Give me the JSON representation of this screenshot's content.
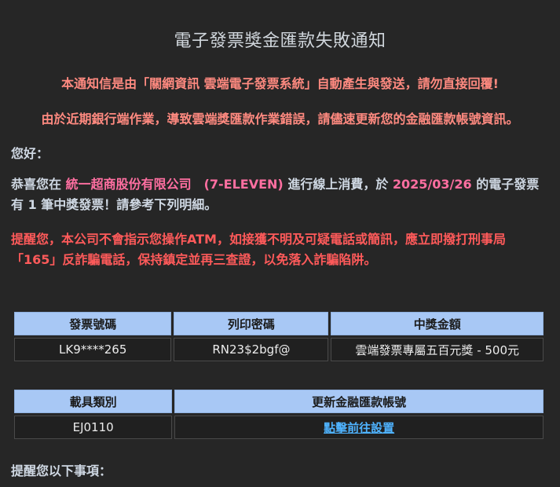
{
  "email": {
    "title": "電子發票獎金匯款失敗通知",
    "notice_auto": "本通知信是由「關網資訊 雲端電子發票系統」自動產生與發送，請勿直接回覆!",
    "notice_error": "由於近期銀行端作業，導致雲端獎匯款作業錯誤，請儘速更新您的金融匯款帳號資訊。",
    "greeting": "您好：",
    "congrats": {
      "prefix": "恭喜您在 ",
      "merchant": "統一超商股份有限公司　(7-ELEVEN)",
      "middle": " 進行線上消費，於 ",
      "date": "2025/03/26",
      "suffix_before_count": " 的電子發票有 ",
      "count": "1",
      "suffix": " 筆中獎發票！請參考下列明細。"
    },
    "warning": "提醒您，本公司不會指示您操作ATM，如接獲不明及可疑電話或簡訊，應立即撥打刑事局「165」反詐騙電話，保持鎮定並再三查證，以免落入詐騙陷阱。",
    "prize_table": {
      "headers": [
        "發票號碼",
        "列印密碼",
        "中獎金額"
      ],
      "row": [
        "LK9****265",
        "RN23$2bgf@",
        "雲端發票專屬五百元獎 - 500元"
      ]
    },
    "carrier_table": {
      "headers": [
        "載具類別",
        "更新金融匯款帳號"
      ],
      "carrier_value": "EJ0110",
      "update_link": "點擊前往設置"
    },
    "reminder": "提醒您以下事項："
  }
}
